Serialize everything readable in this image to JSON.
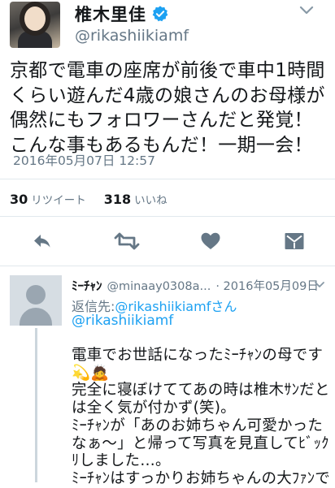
{
  "tweet": {
    "display_name": "椎木里佳",
    "handle": "@rikashiikiamf",
    "text": "京都で電車の座席が前後で車中1時間くらい遊んだ4歳の娘さんのお母様が偶然にもフォロワーさんだと発覚！\nこんな事もあるもんだ！一期一会！",
    "timestamp": "2016年05月07日 12:57",
    "retweet_count": "30",
    "retweet_label": "リツイート",
    "like_count": "318",
    "like_label": "いいね"
  },
  "reply": {
    "display_name": "ﾐｰﾁｬﾝ",
    "handle": "@minaay0308a...",
    "date": "· 2016年05月09日",
    "reply_to_label": "返信先:",
    "reply_to_account": "@rikashiikiamfさん",
    "mention": "@rikashiikiamf",
    "text": "電車でお世話になったﾐｰﾁｬﾝの母です💫🙇\n完全に寝ぼけててあの時は椎木ｻﾝだとは全く気が付かず(笑)。\nﾐｰﾁｬﾝが「あのお姉ちゃん可愛かったなぁ～」と帰って写真を見直してﾋﾞｯｸﾘしました…。\nﾐｰﾁｬﾝはすっかりお姉ちゃんの大ﾌｧﾝで"
  },
  "colors": {
    "accent": "#1da1f2",
    "secondary_text": "#657786",
    "action_icon": "#657786"
  },
  "icons": [
    "verified-badge-icon",
    "chevron-down-icon",
    "reply-icon",
    "retweet-icon",
    "like-heart-icon",
    "direct-message-icon"
  ]
}
